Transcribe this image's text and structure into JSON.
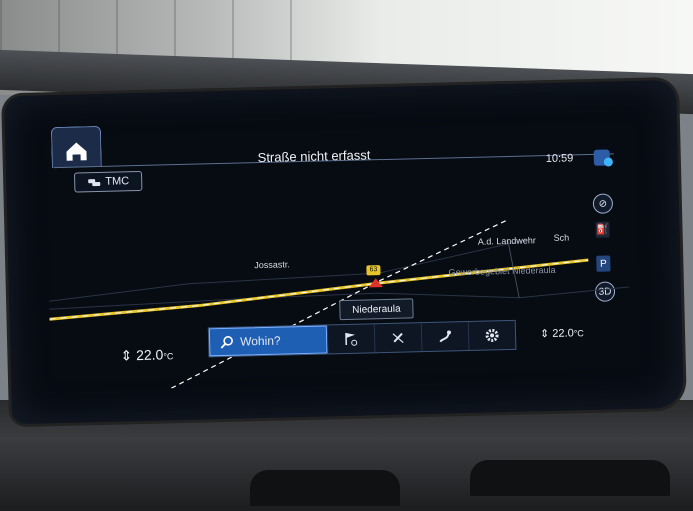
{
  "header": {
    "title": "Straße nicht erfasst",
    "clock": "10:59"
  },
  "tmc": {
    "label": "TMC",
    "icon": "traffic-cars-icon"
  },
  "map": {
    "street_labels": [
      "Jossastr.",
      "A.d. Landwehr",
      "Sch"
    ],
    "area_label": "Gewerbegebiet Niederaula",
    "speed_limit": "63",
    "current_street": "Niederaula"
  },
  "menu": {
    "search_label": "Wohin?",
    "icons": [
      "destination-flag-icon",
      "no-route-icon",
      "route-icon",
      "settings-gear-icon"
    ]
  },
  "climate": {
    "left_temp": "22.0",
    "right_temp": "22.0",
    "unit": "°C"
  },
  "colors": {
    "accent": "#1f5fb3",
    "road": "#e7c52a",
    "screen_bg": "#070b12"
  }
}
